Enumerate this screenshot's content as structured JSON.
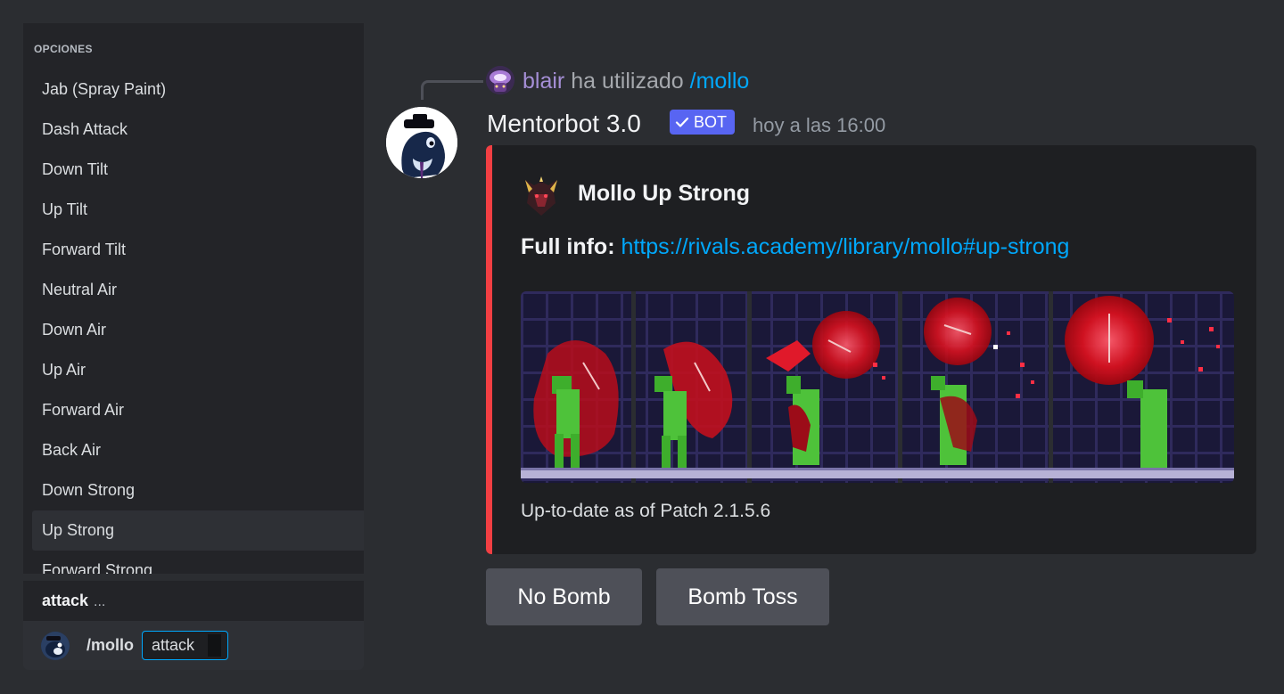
{
  "options_panel": {
    "header": "OPCIONES",
    "items": [
      {
        "label": "Jab (Spray Paint)"
      },
      {
        "label": "Dash Attack"
      },
      {
        "label": "Down Tilt"
      },
      {
        "label": "Up Tilt"
      },
      {
        "label": "Forward Tilt"
      },
      {
        "label": "Neutral Air"
      },
      {
        "label": "Down Air"
      },
      {
        "label": "Up Air"
      },
      {
        "label": "Forward Air"
      },
      {
        "label": "Back Air"
      },
      {
        "label": "Down Strong"
      },
      {
        "label": "Up Strong"
      },
      {
        "label": "Forward Strong"
      }
    ],
    "selected_index": 11
  },
  "option_row": {
    "label": "attack",
    "ellipsis": "..."
  },
  "command_bar": {
    "avatar_icon": "orca-avatar-icon",
    "command": "/mollo",
    "input_value": "attack"
  },
  "reply": {
    "user": "blair",
    "verb": "ha utilizado",
    "command": "/mollo"
  },
  "message": {
    "author": "Mentorbot 3.0",
    "badge": "BOT",
    "timestamp": "hoy a las 16:00"
  },
  "embed": {
    "accent_color": "#f23f43",
    "title": "Mollo Up Strong",
    "info_label": "Full info:",
    "info_link": "https://rivals.academy/library/mollo#up-strong",
    "footer": "Up-to-date as of Patch 2.1.5.6"
  },
  "buttons": {
    "no_bomb": "No Bomb",
    "bomb_toss": "Bomb Toss"
  },
  "colors": {
    "background": "#2b2d31",
    "link": "#00a8fc",
    "badge": "#5865f2",
    "button": "#4e5058"
  }
}
